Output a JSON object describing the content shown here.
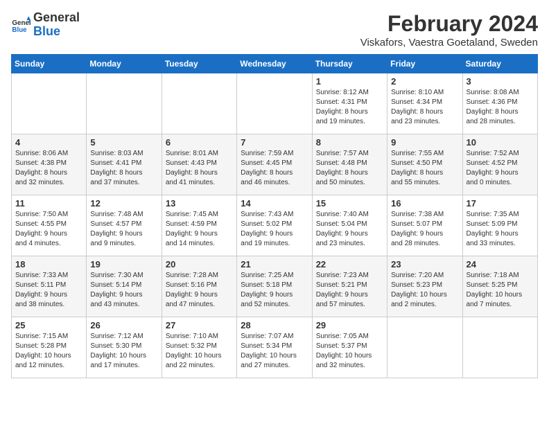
{
  "logo": {
    "line1": "General",
    "line2": "Blue"
  },
  "title": "February 2024",
  "subtitle": "Viskafors, Vaestra Goetaland, Sweden",
  "weekdays": [
    "Sunday",
    "Monday",
    "Tuesday",
    "Wednesday",
    "Thursday",
    "Friday",
    "Saturday"
  ],
  "weeks": [
    [
      {
        "day": "",
        "info": ""
      },
      {
        "day": "",
        "info": ""
      },
      {
        "day": "",
        "info": ""
      },
      {
        "day": "",
        "info": ""
      },
      {
        "day": "1",
        "info": "Sunrise: 8:12 AM\nSunset: 4:31 PM\nDaylight: 8 hours\nand 19 minutes."
      },
      {
        "day": "2",
        "info": "Sunrise: 8:10 AM\nSunset: 4:34 PM\nDaylight: 8 hours\nand 23 minutes."
      },
      {
        "day": "3",
        "info": "Sunrise: 8:08 AM\nSunset: 4:36 PM\nDaylight: 8 hours\nand 28 minutes."
      }
    ],
    [
      {
        "day": "4",
        "info": "Sunrise: 8:06 AM\nSunset: 4:38 PM\nDaylight: 8 hours\nand 32 minutes."
      },
      {
        "day": "5",
        "info": "Sunrise: 8:03 AM\nSunset: 4:41 PM\nDaylight: 8 hours\nand 37 minutes."
      },
      {
        "day": "6",
        "info": "Sunrise: 8:01 AM\nSunset: 4:43 PM\nDaylight: 8 hours\nand 41 minutes."
      },
      {
        "day": "7",
        "info": "Sunrise: 7:59 AM\nSunset: 4:45 PM\nDaylight: 8 hours\nand 46 minutes."
      },
      {
        "day": "8",
        "info": "Sunrise: 7:57 AM\nSunset: 4:48 PM\nDaylight: 8 hours\nand 50 minutes."
      },
      {
        "day": "9",
        "info": "Sunrise: 7:55 AM\nSunset: 4:50 PM\nDaylight: 8 hours\nand 55 minutes."
      },
      {
        "day": "10",
        "info": "Sunrise: 7:52 AM\nSunset: 4:52 PM\nDaylight: 9 hours\nand 0 minutes."
      }
    ],
    [
      {
        "day": "11",
        "info": "Sunrise: 7:50 AM\nSunset: 4:55 PM\nDaylight: 9 hours\nand 4 minutes."
      },
      {
        "day": "12",
        "info": "Sunrise: 7:48 AM\nSunset: 4:57 PM\nDaylight: 9 hours\nand 9 minutes."
      },
      {
        "day": "13",
        "info": "Sunrise: 7:45 AM\nSunset: 4:59 PM\nDaylight: 9 hours\nand 14 minutes."
      },
      {
        "day": "14",
        "info": "Sunrise: 7:43 AM\nSunset: 5:02 PM\nDaylight: 9 hours\nand 19 minutes."
      },
      {
        "day": "15",
        "info": "Sunrise: 7:40 AM\nSunset: 5:04 PM\nDaylight: 9 hours\nand 23 minutes."
      },
      {
        "day": "16",
        "info": "Sunrise: 7:38 AM\nSunset: 5:07 PM\nDaylight: 9 hours\nand 28 minutes."
      },
      {
        "day": "17",
        "info": "Sunrise: 7:35 AM\nSunset: 5:09 PM\nDaylight: 9 hours\nand 33 minutes."
      }
    ],
    [
      {
        "day": "18",
        "info": "Sunrise: 7:33 AM\nSunset: 5:11 PM\nDaylight: 9 hours\nand 38 minutes."
      },
      {
        "day": "19",
        "info": "Sunrise: 7:30 AM\nSunset: 5:14 PM\nDaylight: 9 hours\nand 43 minutes."
      },
      {
        "day": "20",
        "info": "Sunrise: 7:28 AM\nSunset: 5:16 PM\nDaylight: 9 hours\nand 47 minutes."
      },
      {
        "day": "21",
        "info": "Sunrise: 7:25 AM\nSunset: 5:18 PM\nDaylight: 9 hours\nand 52 minutes."
      },
      {
        "day": "22",
        "info": "Sunrise: 7:23 AM\nSunset: 5:21 PM\nDaylight: 9 hours\nand 57 minutes."
      },
      {
        "day": "23",
        "info": "Sunrise: 7:20 AM\nSunset: 5:23 PM\nDaylight: 10 hours\nand 2 minutes."
      },
      {
        "day": "24",
        "info": "Sunrise: 7:18 AM\nSunset: 5:25 PM\nDaylight: 10 hours\nand 7 minutes."
      }
    ],
    [
      {
        "day": "25",
        "info": "Sunrise: 7:15 AM\nSunset: 5:28 PM\nDaylight: 10 hours\nand 12 minutes."
      },
      {
        "day": "26",
        "info": "Sunrise: 7:12 AM\nSunset: 5:30 PM\nDaylight: 10 hours\nand 17 minutes."
      },
      {
        "day": "27",
        "info": "Sunrise: 7:10 AM\nSunset: 5:32 PM\nDaylight: 10 hours\nand 22 minutes."
      },
      {
        "day": "28",
        "info": "Sunrise: 7:07 AM\nSunset: 5:34 PM\nDaylight: 10 hours\nand 27 minutes."
      },
      {
        "day": "29",
        "info": "Sunrise: 7:05 AM\nSunset: 5:37 PM\nDaylight: 10 hours\nand 32 minutes."
      },
      {
        "day": "",
        "info": ""
      },
      {
        "day": "",
        "info": ""
      }
    ]
  ]
}
